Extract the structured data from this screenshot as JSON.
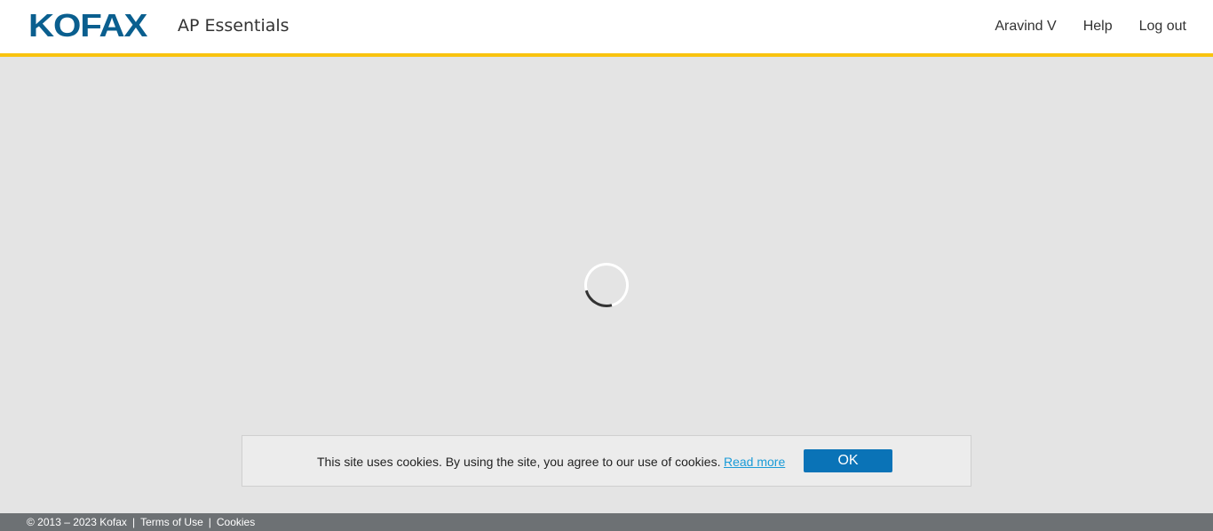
{
  "header": {
    "logo_text": "KOFAX",
    "app_title": "AP Essentials",
    "nav": {
      "user": "Aravind V",
      "help": "Help",
      "logout": "Log out"
    }
  },
  "main": {
    "loading_indicator": "spinner-icon"
  },
  "cookie_banner": {
    "message": "This site uses cookies. By using the site, you agree to our use of cookies.",
    "read_more": "Read more",
    "ok_label": "OK"
  },
  "footer": {
    "copyright": "© 2013 – 2023 Kofax",
    "separator": "|",
    "terms": "Terms of Use",
    "cookies": "Cookies"
  },
  "colors": {
    "brand_blue": "#0a5f8f",
    "accent_yellow": "#f9c30f",
    "button_blue": "#0a73b7",
    "link_blue": "#1a9bd7",
    "footer_gray": "#6d7174",
    "page_background": "#e4e4e4"
  }
}
